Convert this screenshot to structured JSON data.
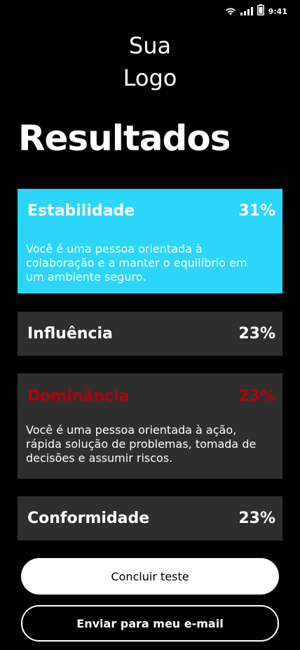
{
  "status": {
    "time": "9:41"
  },
  "logo": {
    "line1": "Sua",
    "line2": "Logo"
  },
  "page": {
    "title": "Resultados"
  },
  "results": [
    {
      "name": "Estabilidade",
      "percent": "31%",
      "description": "Você é uma pessoa orientada à colaboração e a manter o equilíbrio em um ambiente seguro.",
      "bg": "#2bd6fa",
      "name_color": "#ffffff"
    },
    {
      "name": "Influência",
      "percent": "23%",
      "bg": "#2e2e2e",
      "name_color": "#ffffff"
    },
    {
      "name": "Dominância",
      "percent": "23%",
      "description": "Você é uma pessoa orientada à ação, rápida solução de problemas, tomada de decisões e assumir riscos.",
      "bg": "#2e2e2e",
      "name_color": "#b3000c"
    },
    {
      "name": "Conformidade",
      "percent": "23%",
      "bg": "#2e2e2e",
      "name_color": "#ffffff"
    }
  ],
  "actions": {
    "finish_label": "Concluir teste",
    "email_label": "Enviar para meu e-mail"
  },
  "icons": [
    "wifi-icon",
    "signal-icon",
    "battery-icon"
  ]
}
